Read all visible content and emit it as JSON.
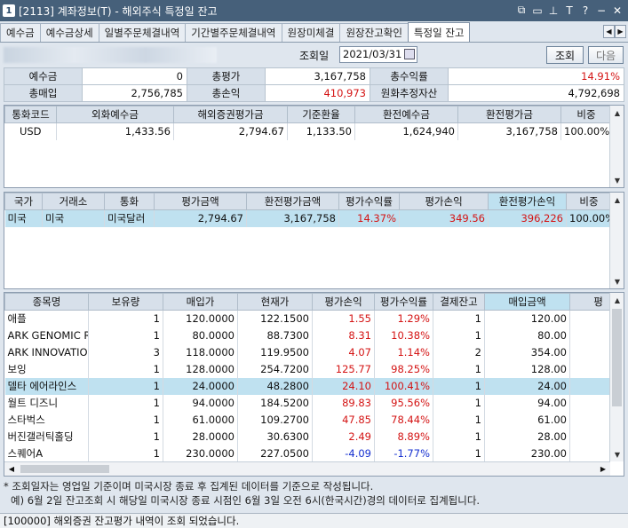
{
  "window": {
    "num": "1",
    "title": "[2113] 계좌정보(T) - 해외주식 특정일 잔고"
  },
  "titlebar_icons": [
    "window-icon",
    "window-icon",
    "pin-icon",
    "font-icon",
    "help-icon",
    "minimize-icon",
    "close-icon"
  ],
  "titlebar_glyphs": {
    "win1": "⧉",
    "win2": "▭",
    "pin": "⊥",
    "font": "T",
    "help": "?",
    "min": "−",
    "close": "✕"
  },
  "tabs": [
    "예수금",
    "예수금상세",
    "일별주문체결내역",
    "기간별주문체결내역",
    "원장미체결",
    "원장잔고확인",
    "특정일 잔고"
  ],
  "active_tab": "특정일 잔고",
  "query": {
    "date_label": "조회일",
    "date": "2021/03/31",
    "search": "조회",
    "next": "다음"
  },
  "summary": {
    "deposit_label": "예수금",
    "deposit": "0",
    "total_eval_label": "총평가",
    "total_eval": "3,167,758",
    "total_return_label": "총수익률",
    "total_return": "14.91%",
    "total_buy_label": "총매입",
    "total_buy": "2,756,785",
    "total_pl_label": "총손익",
    "total_pl": "410,973",
    "krw_assets_label": "원화추정자산",
    "krw_assets": "4,792,698"
  },
  "currency_grid": {
    "headers": [
      "통화코드",
      "외화예수금",
      "해외증권평가금",
      "기준환율",
      "환전예수금",
      "환전평가금",
      "비중"
    ],
    "rows": [
      [
        "USD",
        "1,433.56",
        "2,794.67",
        "1,133.50",
        "1,624,940",
        "3,167,758",
        "100.00%"
      ]
    ]
  },
  "country_grid": {
    "headers": [
      "국가",
      "거래소",
      "통화",
      "평가금액",
      "환전평가금액",
      "평가수익률",
      "평가손익",
      "환전평가손익",
      "비중"
    ],
    "rows": [
      [
        "미국",
        "미국",
        "미국달러",
        "2,794.67",
        "3,167,758",
        "14.37%",
        "349.56",
        "396,226",
        "100.00%"
      ]
    ]
  },
  "stock_grid": {
    "headers": [
      "종목명",
      "보유량",
      "매입가",
      "현재가",
      "평가손익",
      "평가수익률",
      "결제잔고",
      "매입금액",
      "평"
    ],
    "rows": [
      [
        "애플",
        "1",
        "120.0000",
        "122.1500",
        "1.55",
        "1.29%",
        "1",
        "120.00"
      ],
      [
        "ARK GENOMIC REV",
        "1",
        "80.0000",
        "88.7300",
        "8.31",
        "10.38%",
        "1",
        "80.00"
      ],
      [
        "ARK INNOVATION",
        "3",
        "118.0000",
        "119.9500",
        "4.07",
        "1.14%",
        "2",
        "354.00"
      ],
      [
        "보잉",
        "1",
        "128.0000",
        "254.7200",
        "125.77",
        "98.25%",
        "1",
        "128.00"
      ],
      [
        "델타 에어라인스",
        "1",
        "24.0000",
        "48.2800",
        "24.10",
        "100.41%",
        "1",
        "24.00"
      ],
      [
        "월트 디즈니",
        "1",
        "94.0000",
        "184.5200",
        "89.83",
        "95.56%",
        "1",
        "94.00"
      ],
      [
        "스타벅스",
        "1",
        "61.0000",
        "109.2700",
        "47.85",
        "78.44%",
        "1",
        "61.00"
      ],
      [
        "버진갤러틱홀딩",
        "1",
        "28.0000",
        "30.6300",
        "2.49",
        "8.89%",
        "1",
        "28.00"
      ],
      [
        "스퀘어A",
        "1",
        "230.0000",
        "227.0500",
        "-4.09",
        "-1.77%",
        "1",
        "230.00"
      ]
    ]
  },
  "notes": [
    "* 조회일자는 영업일 기준이며 미국시장 종료 후 집계된 데이터를 기준으로 작성됩니다.",
    "예) 6월 2일 잔고조회 시 해당일 미국시장 종료 시점인 6월 3일 오전 6시(한국시간)경의 데이터로 집계됩니다."
  ],
  "status": "[100000] 해외증권 잔고평가 내역이 조회 되었습니다.",
  "colors": {
    "positive": "#d41414",
    "negative": "#1630d0",
    "selected_row": "#bfe1f0"
  }
}
